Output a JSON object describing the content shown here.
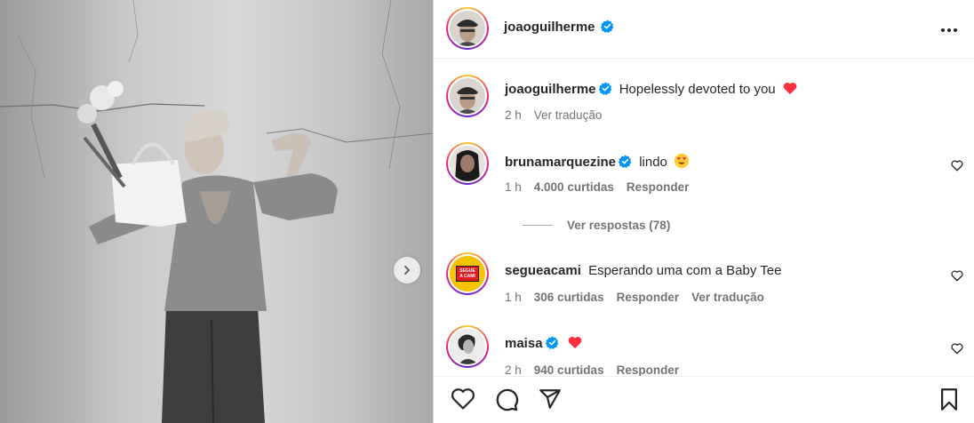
{
  "post": {
    "author": "joaoguilherme",
    "caption": "Hopelessly devoted to you",
    "caption_time": "2 h",
    "caption_translate": "Ver tradução"
  },
  "comments": [
    {
      "username": "brunamarquezine",
      "text": "lindo",
      "time": "1 h",
      "likes": "4.000 curtidas",
      "reply": "Responder"
    },
    {
      "username": "segueacami",
      "text": "Esperando uma com a Baby Tee",
      "time": "1 h",
      "likes": "306 curtidas",
      "reply": "Responder",
      "translate": "Ver tradução",
      "avatar_text": "SEGUE A CAMI"
    },
    {
      "username": "maisa",
      "text": "",
      "time": "2 h",
      "likes": "940 curtidas",
      "reply": "Responder"
    }
  ],
  "view_replies": "Ver respostas (78)",
  "colors": {
    "verified": "#0095f6",
    "heart": "#ff3040",
    "meta_text": "#737373"
  },
  "icons": [
    "verified-icon",
    "more-icon",
    "heart-icon",
    "comment-icon",
    "share-icon",
    "bookmark-icon",
    "chevron-right-icon"
  ]
}
